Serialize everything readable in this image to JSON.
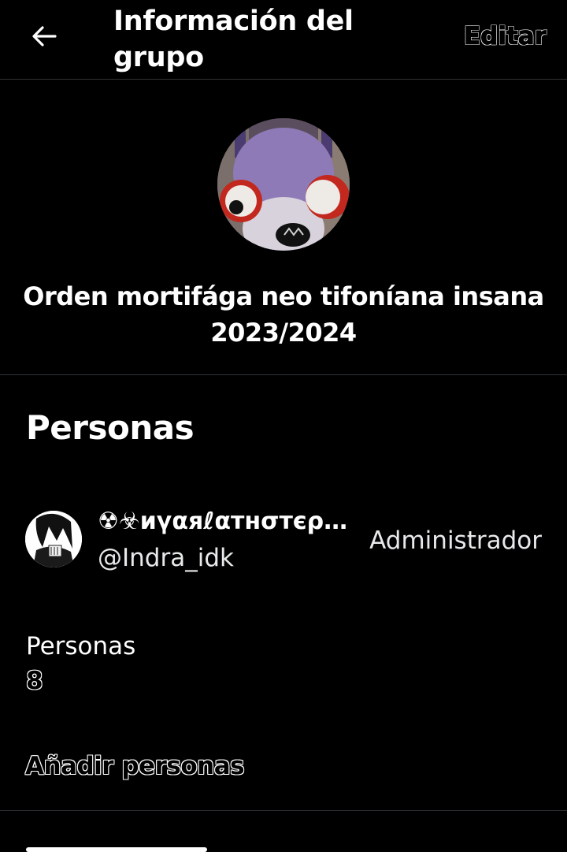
{
  "header": {
    "title": "Información del grupo",
    "edit_label": "Editar",
    "back_icon": "arrow-left-icon"
  },
  "group": {
    "name": "Orden mortifága neo tifoníana insana 2023/2024",
    "avatar": "group-photo-purple-plush"
  },
  "people_section": {
    "title": "Personas",
    "members": [
      {
        "display_name": "☢☣иүαяℓαтнσтєρ…",
        "handle": "@Indra_idk",
        "role": "Administrador",
        "avatar": "member-avatar-drawing"
      }
    ],
    "count_label": "Personas",
    "count_value": "8",
    "add_label": "Añadir personas"
  },
  "colors": {
    "background": "#000000",
    "text": "#ffffff",
    "divider": "#2f3336"
  }
}
